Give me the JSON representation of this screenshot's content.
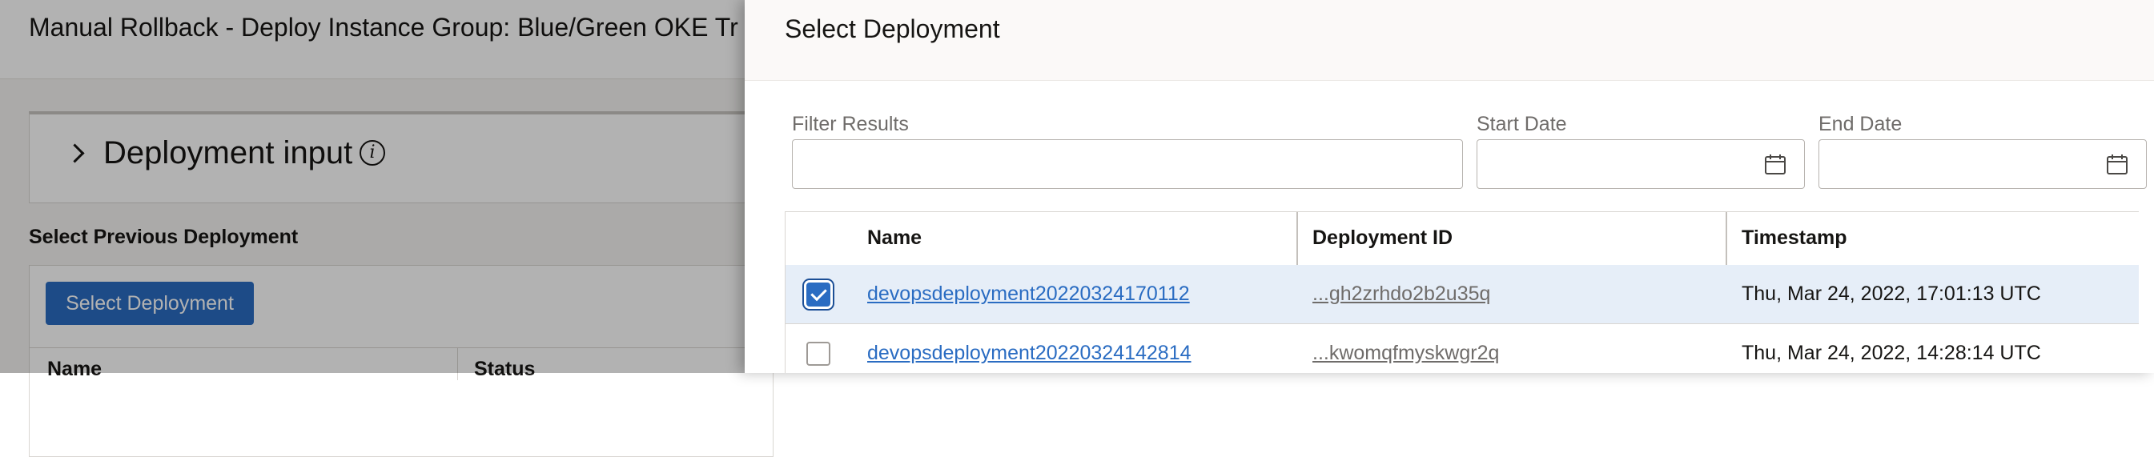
{
  "background": {
    "title": "Manual Rollback - Deploy Instance Group: Blue/Green OKE Tr",
    "deployment_input_label": "Deployment input",
    "info_icon_glyph": "i",
    "select_previous_label": "Select Previous Deployment",
    "select_deployment_button": "Select Deployment",
    "table_columns": [
      "Name",
      "Status"
    ]
  },
  "drawer": {
    "title": "Select Deployment",
    "filters": {
      "filter_results_label": "Filter Results",
      "filter_results_value": "",
      "start_date_label": "Start Date",
      "start_date_value": "",
      "end_date_label": "End Date",
      "end_date_value": ""
    },
    "table": {
      "columns": [
        "Name",
        "Deployment ID",
        "Timestamp"
      ],
      "rows": [
        {
          "selected": true,
          "name": "devopsdeployment20220324170112",
          "deployment_id": "...gh2zrhdo2b2u35q",
          "timestamp": "Thu, Mar 24, 2022, 17:01:13 UTC"
        },
        {
          "selected": false,
          "name": "devopsdeployment20220324142814",
          "deployment_id": "...kwomqfmyskwgr2q",
          "timestamp": "Thu, Mar 24, 2022, 14:28:14 UTC"
        }
      ]
    }
  },
  "colors": {
    "accent": "#2a6cc2",
    "selected_row": "#e6eef8",
    "scrim": "rgba(0,0,0,0.3)"
  },
  "icons": [
    "chevron-right-icon",
    "info-icon",
    "calendar-icon",
    "checkbox-checked-icon",
    "checkbox-empty-icon"
  ]
}
